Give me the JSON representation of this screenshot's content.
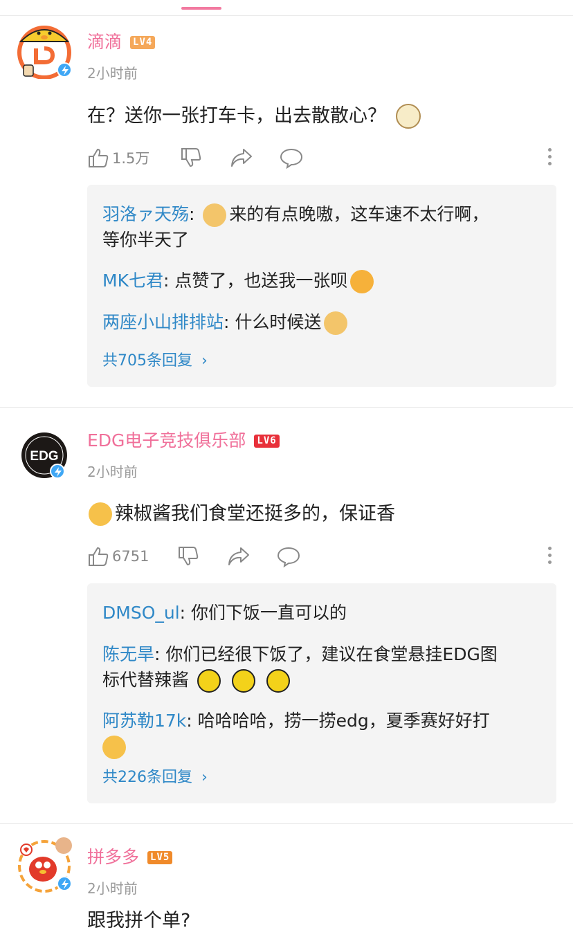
{
  "comments": [
    {
      "username": "滴滴",
      "level": "LV4",
      "level_color": "#f5a85a",
      "time": "2小时前",
      "text": "在？送你一张打车卡，出去散散心？",
      "likes": "1.5万",
      "replies": [
        {
          "name": "羽洛ァ天殇",
          "text_before": "",
          "text": "来的有点晚嗷，这车速不太行啊，",
          "text2": "等你半天了"
        },
        {
          "name": "MK七君",
          "text": "点赞了，也送我一张呗"
        },
        {
          "name": "两座小山排排站",
          "text": "什么时候送"
        }
      ],
      "more_replies": "共705条回复"
    },
    {
      "username": "EDG电子竞技俱乐部",
      "level": "LV6",
      "level_color": "#e8303a",
      "time": "2小时前",
      "text": "辣椒酱我们食堂还挺多的，保证香",
      "likes": "6751",
      "replies": [
        {
          "name": "DMSO_ul",
          "text": "你们下饭一直可以的"
        },
        {
          "name": "陈无旱",
          "text": "你们已经很下饭了，建议在食堂悬挂EDG图",
          "text2": "标代替辣酱"
        },
        {
          "name": "阿苏勒17k",
          "text": "哈哈哈哈，捞一捞edg，夏季赛好好打"
        }
      ],
      "more_replies": "共226条回复"
    },
    {
      "username": "拼多多",
      "level": "LV5",
      "level_color": "#f08a2a",
      "time": "2小时前",
      "text": "跟我拼个单?"
    }
  ],
  "avatars": {
    "didi_logo_text": "",
    "edg_logo_text": "EDG"
  },
  "colors": {
    "username": "#f0709a",
    "reply_name": "#2f88c7",
    "verify": "#3fa7f5"
  },
  "icons": [
    "thumbs-up-icon",
    "thumbs-down-icon",
    "share-icon",
    "comment-icon",
    "more-icon",
    "chevron-right-icon"
  ]
}
